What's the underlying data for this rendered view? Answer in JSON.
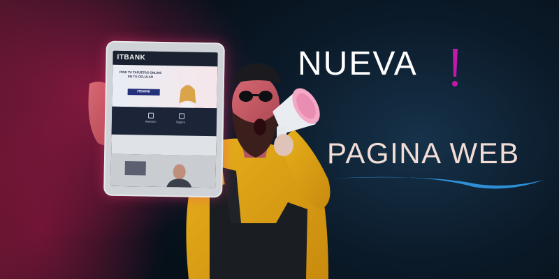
{
  "headline": {
    "line1": "NUEVA",
    "line2": "PAGINA WEB",
    "accent_color": "#c01ba8",
    "swoosh_color": "#2f8fd6"
  },
  "tablet": {
    "brand": "ITBANK",
    "hero_text": "PIDE TU TARJETAS ONLINE EN TU CELULAR",
    "ribbon": "ITBANK",
    "item_1": "Atención",
    "item_2": "Seguro"
  }
}
